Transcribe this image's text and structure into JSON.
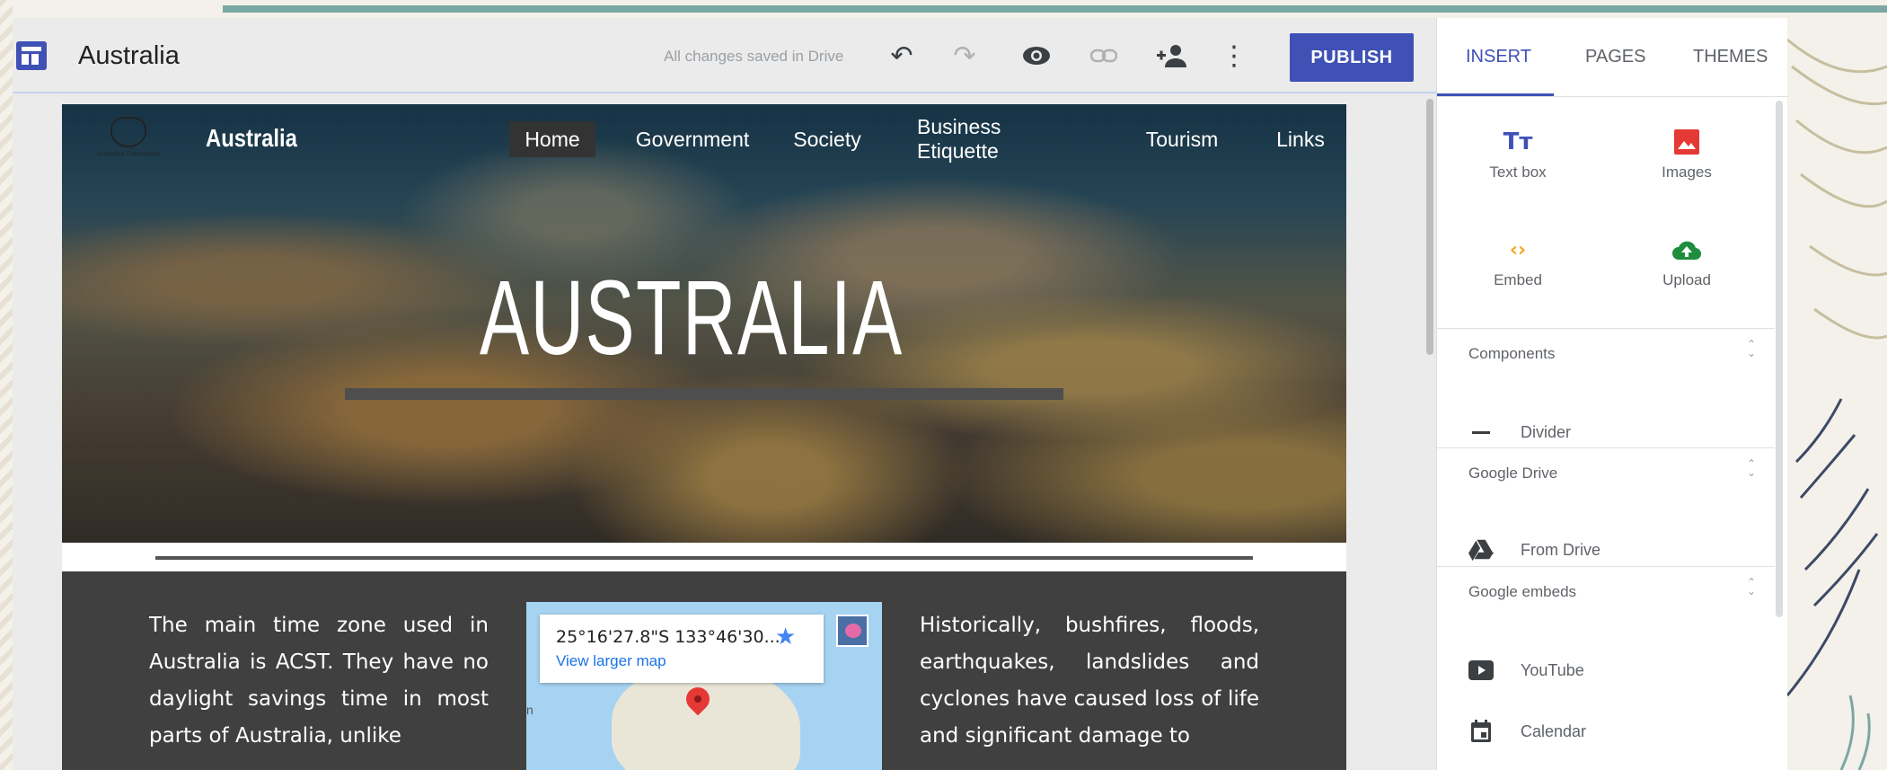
{
  "editor": {
    "title": "Australia",
    "save_status": "All changes saved in Drive",
    "publish_label": "PUBLISH"
  },
  "site": {
    "brand": "Australia",
    "logo_caption": "Australian Government",
    "nav": [
      "Home",
      "Government",
      "Society",
      "Business Etiquette",
      "Tourism",
      "Links"
    ],
    "active_nav": "Home",
    "hero_title": "AUSTRALIA",
    "left_text": "The main time zone used in Australia is ACST. They have no daylight savings time in most parts of Australia, unlike",
    "right_text": "Historically, bushfires, floods, earthquakes, landslides and cyclones have caused loss of life and significant damage to"
  },
  "map": {
    "coords": "25°16'27.8\"S 133°46'30....",
    "larger_link": "View larger map",
    "edge_letter": "n"
  },
  "panel": {
    "tabs": [
      "INSERT",
      "PAGES",
      "THEMES"
    ],
    "active_tab": "INSERT",
    "tiles": [
      {
        "label": "Text box",
        "icon": "text-box-icon"
      },
      {
        "label": "Images",
        "icon": "image-icon"
      },
      {
        "label": "Embed",
        "icon": "embed-icon"
      },
      {
        "label": "Upload",
        "icon": "upload-icon"
      }
    ],
    "sections": {
      "components": {
        "title": "Components",
        "items": [
          "Divider"
        ]
      },
      "drive": {
        "title": "Google Drive",
        "items": [
          "From Drive"
        ]
      },
      "embeds": {
        "title": "Google embeds",
        "items": [
          "YouTube",
          "Calendar"
        ]
      }
    }
  },
  "colors": {
    "accent": "#3f51b5",
    "panel_tile_text": "#3f51b5",
    "images_red": "#e53935",
    "embed_orange": "#f4a71f",
    "upload_green": "#1e8e3e"
  }
}
